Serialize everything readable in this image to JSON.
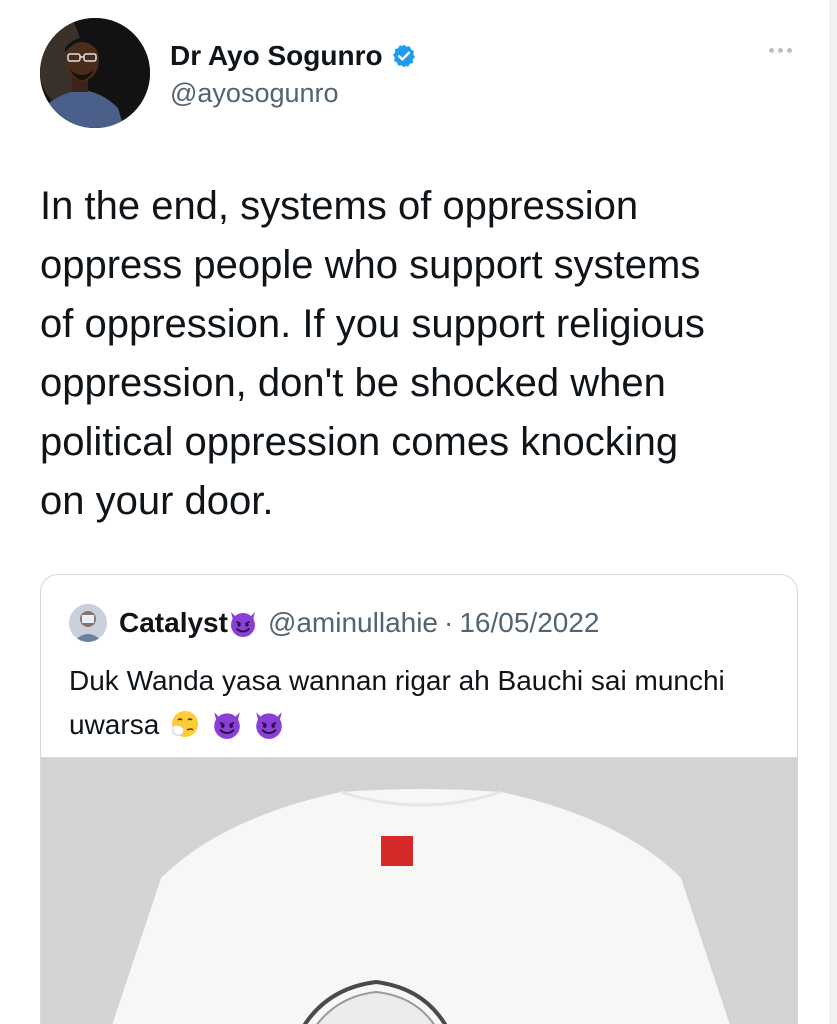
{
  "tweet": {
    "author": {
      "display_name": "Dr Ayo Sogunro",
      "handle": "@ayosogunro",
      "verified_icon": "verified-badge-icon",
      "verified_color": "#1d9bf0"
    },
    "more_icon": "more-dots-icon",
    "text": "In the end, systems of oppression\noppress people who support systems\nof oppression. If you support religious\noppression, don't be shocked when\npolitical oppression comes knocking\non your door."
  },
  "quote": {
    "author": {
      "display_name": "Catalyst",
      "name_emoji": "smiling-devil-emoji",
      "handle": "@aminullahie",
      "separator": "·",
      "date": "16/05/2022"
    },
    "text": "Duk Wanda yasa wannan rigar ah Bauchi sai munchi uwarsa",
    "trailing_emojis": [
      "sneezing-face-emoji",
      "smiling-devil-emoji",
      "smiling-devil-emoji"
    ],
    "media": {
      "kind": "photo",
      "subject_icon": "white-tshirt-image"
    }
  },
  "colors": {
    "text_primary": "#0f1419",
    "text_secondary": "#536471",
    "border": "#cfd9de",
    "devil_purple": "#8a3fd6"
  }
}
